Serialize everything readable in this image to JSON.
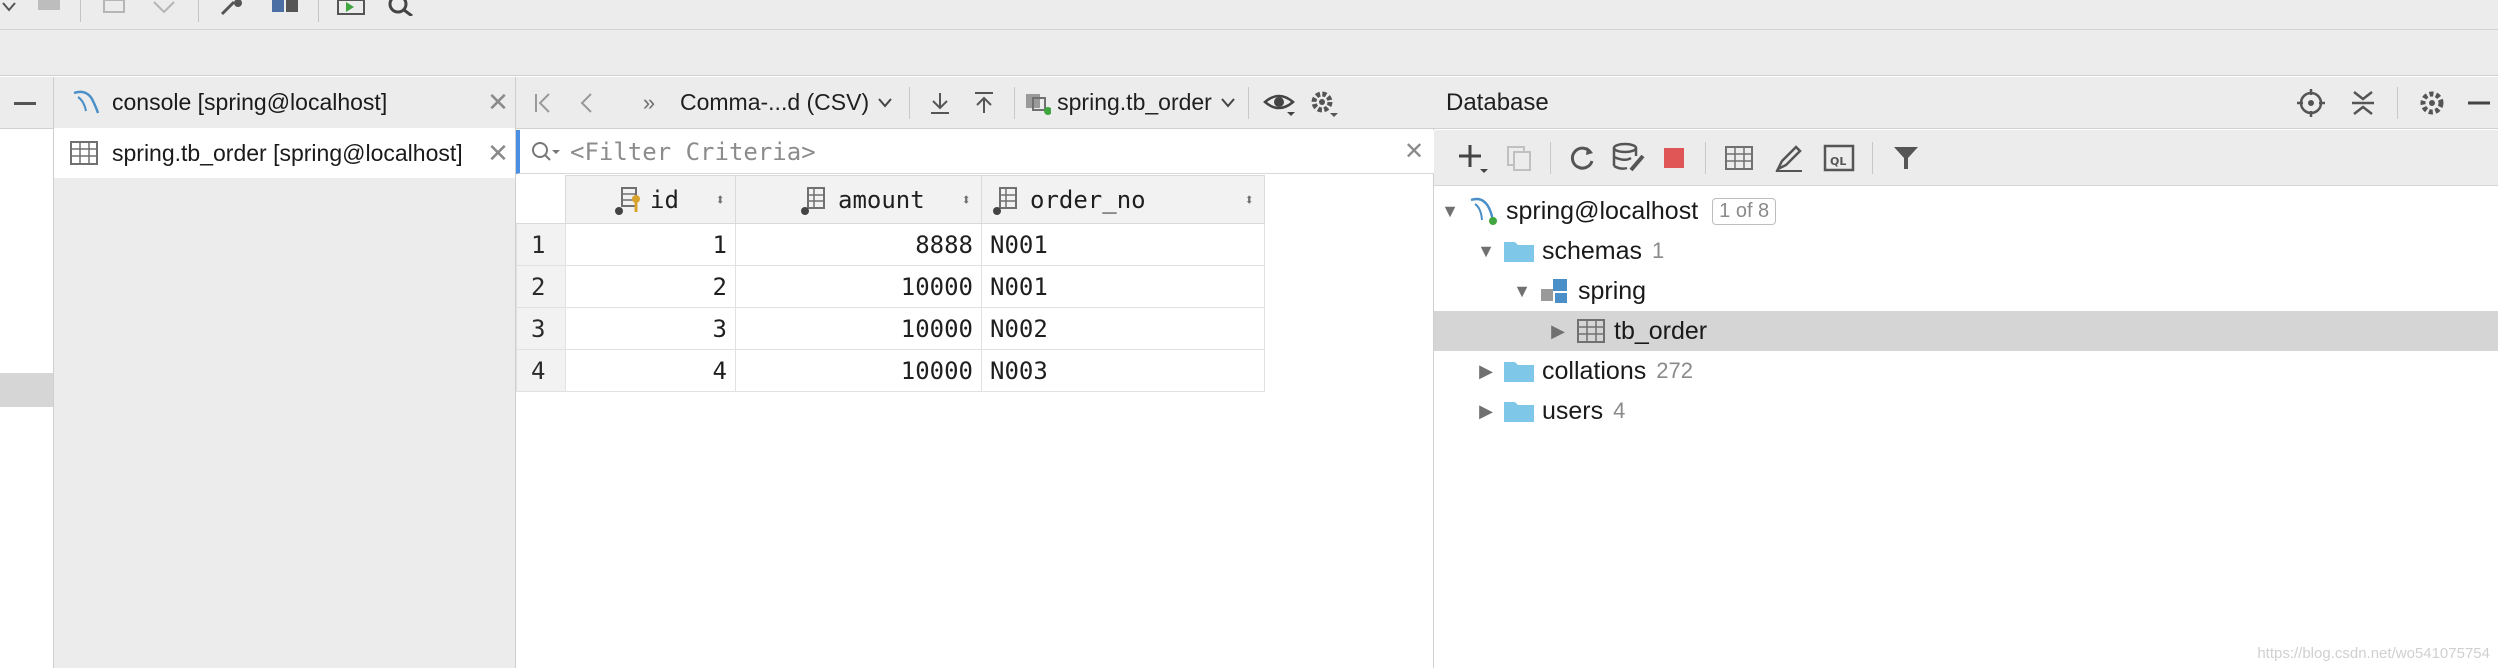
{
  "editor_tabs": [
    {
      "label": "console [spring@localhost]",
      "icon": "mysql-dolphin-icon"
    },
    {
      "label": "spring.tb_order [spring@localhost]",
      "icon": "table-icon"
    }
  ],
  "grid_toolbar": {
    "export_format": "Comma-...d (CSV)",
    "table_selector": "spring.tb_order",
    "more_label": "»"
  },
  "filter": {
    "placeholder": "<Filter Criteria>"
  },
  "table": {
    "columns": [
      {
        "name": "id",
        "icon": "primary-key-column-icon"
      },
      {
        "name": "amount",
        "icon": "column-icon"
      },
      {
        "name": "order_no",
        "icon": "column-icon"
      }
    ],
    "rows": [
      {
        "num": "1",
        "id": "1",
        "amount": "8888",
        "order_no": "N001"
      },
      {
        "num": "2",
        "id": "2",
        "amount": "10000",
        "order_no": "N001"
      },
      {
        "num": "3",
        "id": "3",
        "amount": "10000",
        "order_no": "N002"
      },
      {
        "num": "4",
        "id": "4",
        "amount": "10000",
        "order_no": "N003"
      }
    ]
  },
  "database_panel": {
    "title": "Database",
    "tree": {
      "host": {
        "label": "spring@localhost",
        "badge": "1 of 8"
      },
      "schemas": {
        "label": "schemas",
        "count": "1"
      },
      "schema": {
        "label": "spring"
      },
      "table": {
        "label": "tb_order"
      },
      "collations": {
        "label": "collations",
        "count": "272"
      },
      "users": {
        "label": "users",
        "count": "4"
      }
    }
  },
  "watermark": "https://blog.csdn.net/wo541075754",
  "colors": {
    "accent_blue": "#4a8fe3",
    "stop_red": "#e05555",
    "folder_blue": "#7fc7e8",
    "run_green": "#3fa63f"
  }
}
